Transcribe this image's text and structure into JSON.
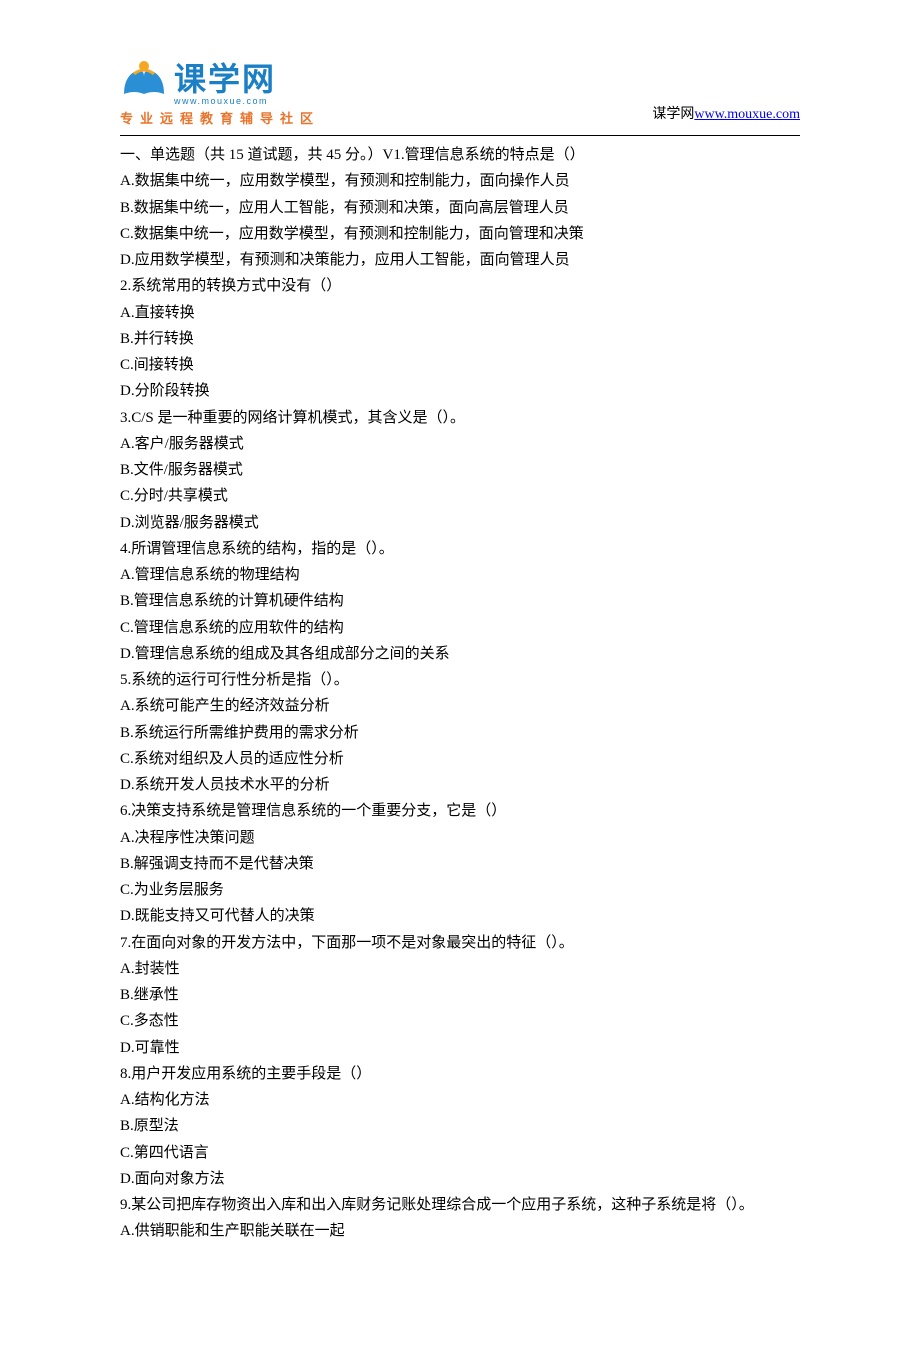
{
  "header": {
    "logo_text": "课学网",
    "logo_url": "www.mouxue.com",
    "tagline": "专业远程教育辅导社区",
    "site_label": "谋学网",
    "site_link_text": "www.mouxue.com",
    "site_link_href": "http://www.mouxue.com"
  },
  "content": {
    "section_header": "一、单选题（共 15 道试题，共 45 分。）V1.管理信息系统的特点是（）",
    "lines": [
      "A.数据集中统一，应用数学模型，有预测和控制能力，面向操作人员",
      "B.数据集中统一，应用人工智能，有预测和决策，面向高层管理人员",
      "C.数据集中统一，应用数学模型，有预测和控制能力，面向管理和决策",
      "D.应用数学模型，有预测和决策能力，应用人工智能，面向管理人员",
      "2.系统常用的转换方式中没有（）",
      "A.直接转换",
      "B.并行转换",
      "C.间接转换",
      "D.分阶段转换",
      "3.C/S 是一种重要的网络计算机模式，其含义是（）。",
      "A.客户/服务器模式",
      "B.文件/服务器模式",
      "C.分时/共享模式",
      "D.浏览器/服务器模式",
      "4.所谓管理信息系统的结构，指的是（）。",
      "A.管理信息系统的物理结构",
      "B.管理信息系统的计算机硬件结构",
      "C.管理信息系统的应用软件的结构",
      "D.管理信息系统的组成及其各组成部分之间的关系",
      "5.系统的运行可行性分析是指（）。",
      "A.系统可能产生的经济效益分析",
      "B.系统运行所需维护费用的需求分析",
      "C.系统对组织及人员的适应性分析",
      "D.系统开发人员技术水平的分析",
      "6.决策支持系统是管理信息系统的一个重要分支，它是（）",
      "A.决程序性决策问题",
      "B.解强调支持而不是代替决策",
      "C.为业务层服务",
      "D.既能支持又可代替人的决策",
      "7.在面向对象的开发方法中，下面那一项不是对象最突出的特征（）。",
      "A.封装性",
      "B.继承性",
      "C.多态性",
      "D.可靠性",
      "8.用户开发应用系统的主要手段是（）",
      "A.结构化方法",
      "B.原型法",
      "C.第四代语言",
      "D.面向对象方法",
      "9.某公司把库存物资出入库和出入库财务记账处理综合成一个应用子系统，这种子系统是将（）。",
      "A.供销职能和生产职能关联在一起"
    ]
  }
}
